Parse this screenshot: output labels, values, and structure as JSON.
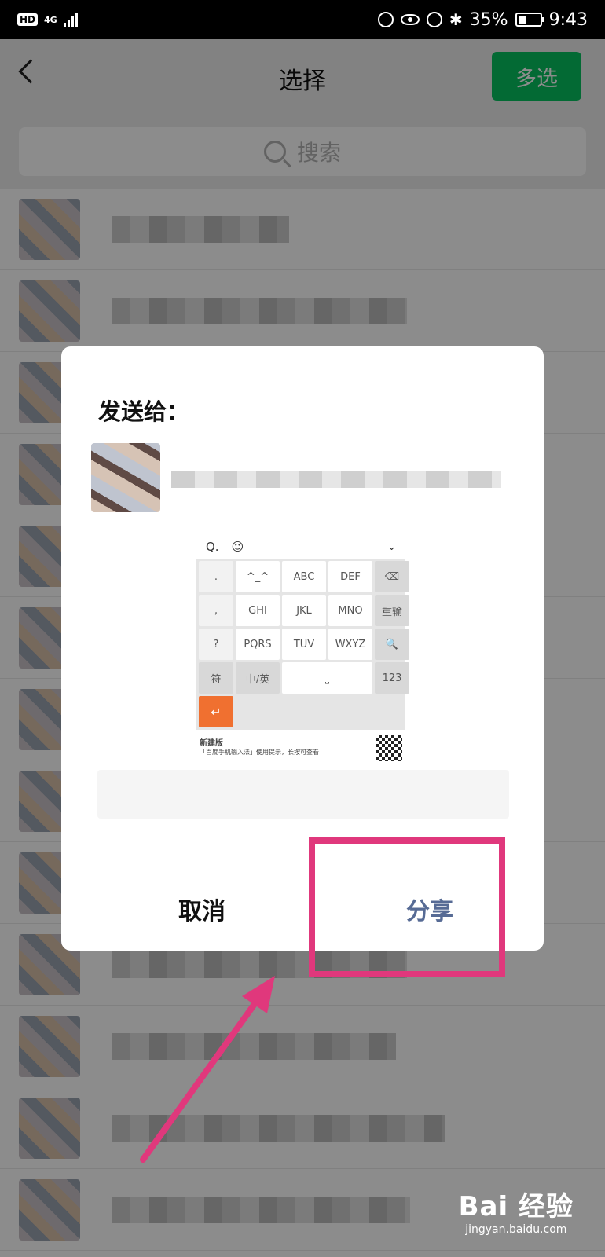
{
  "status_bar": {
    "hd_badge": "HD",
    "network": "4G",
    "battery_text": "35%",
    "time": "9:43",
    "battery_level_percent": 35
  },
  "header": {
    "title": "选择",
    "multi_select_label": "多选"
  },
  "search": {
    "placeholder": "搜索"
  },
  "dialog": {
    "send_to_label": "发送给：",
    "cancel_label": "取消",
    "share_label": "分享",
    "preview": {
      "keys_row1": [
        "'",
        "ABC",
        "DEF",
        "⌫"
      ],
      "keys_row1_first": "^_^",
      "keys_row2": [
        "GHI",
        "JKL",
        "MNO",
        "重输"
      ],
      "keys_row3": [
        "PQRS",
        "TUV",
        "WXYZ"
      ],
      "key_num": "123",
      "key_lang": "中/英",
      "key_symbol": "符",
      "key_enter": "↵",
      "foot_title": "新建版",
      "foot_text": "「百度手机输入法」使用提示，长按可查看",
      "side_keys": [
        ".",
        ",",
        "?",
        "!"
      ]
    }
  },
  "watermark": {
    "logo": "Bai 经验",
    "url": "jingyan.baidu.com"
  },
  "colors": {
    "accent_green": "#07c160",
    "share_blue": "#576b95",
    "highlight_pink": "#e0387c",
    "enter_orange": "#f07030"
  }
}
